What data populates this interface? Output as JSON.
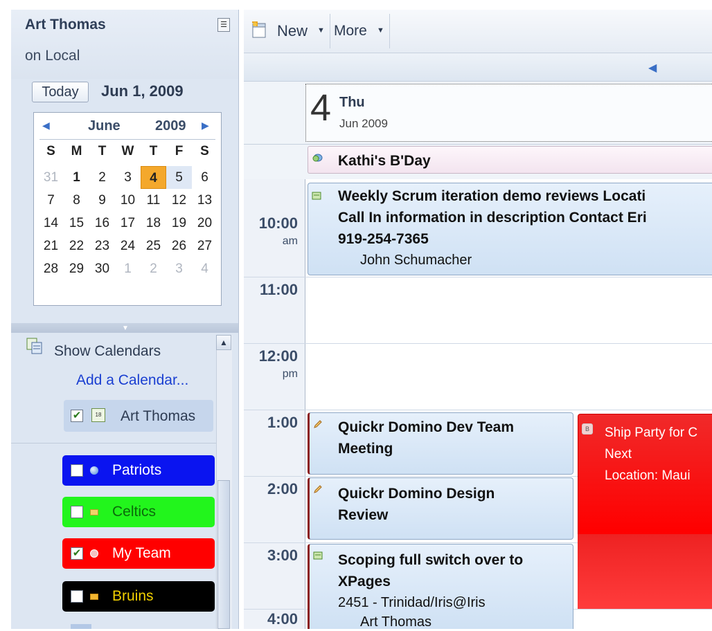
{
  "sidebar": {
    "owner_name": "Art Thomas",
    "owner_location": "on Local",
    "today_button": "Today",
    "current_date": "Jun 1, 2009",
    "mini_calendar": {
      "month": "June",
      "year": "2009",
      "weekdays": [
        "S",
        "M",
        "T",
        "W",
        "T",
        "F",
        "S"
      ],
      "weeks": [
        [
          "31",
          "1",
          "2",
          "3",
          "4",
          "5",
          "6"
        ],
        [
          "7",
          "8",
          "9",
          "10",
          "11",
          "12",
          "13"
        ],
        [
          "14",
          "15",
          "16",
          "17",
          "18",
          "19",
          "20"
        ],
        [
          "21",
          "22",
          "23",
          "24",
          "25",
          "26",
          "27"
        ],
        [
          "28",
          "29",
          "30",
          "1",
          "2",
          "3",
          "4"
        ]
      ]
    },
    "show_calendars": "Show Calendars",
    "add_calendar": "Add a Calendar...",
    "own_calendar": "Art Thomas",
    "calendars": [
      {
        "label": "Patriots",
        "color": "#0a14f0",
        "checked": false
      },
      {
        "label": "Celtics",
        "color": "#22f51c",
        "checked": false
      },
      {
        "label": "My Team",
        "color": "#ff0000",
        "checked": true
      },
      {
        "label": "Bruins",
        "color": "#000000",
        "checked": false
      }
    ]
  },
  "toolbar": {
    "new_label": "New",
    "more_label": "More"
  },
  "day_header": {
    "day_number": "4",
    "day_name": "Thu",
    "month_year": "Jun 2009"
  },
  "all_day_event": "Kathi's B'Day",
  "time_labels": [
    {
      "hour": "10:00",
      "ampm": "am"
    },
    {
      "hour": "11:00",
      "ampm": ""
    },
    {
      "hour": "12:00",
      "ampm": "pm"
    },
    {
      "hour": "1:00",
      "ampm": ""
    },
    {
      "hour": "2:00",
      "ampm": ""
    },
    {
      "hour": "3:00",
      "ampm": ""
    },
    {
      "hour": "4:00",
      "ampm": ""
    }
  ],
  "events": {
    "scrum": {
      "line1": "Weekly Scrum iteration demo reviews Locati",
      "line2": "Call In information in description Contact Eri",
      "line3": "919-254-7365",
      "person": "John Schumacher"
    },
    "dev_meeting": {
      "line1": "Quickr Domino Dev Team",
      "line2": "Meeting"
    },
    "design_review": {
      "line1": "Quickr Domino Design",
      "line2": "Review"
    },
    "scoping": {
      "line1": "Scoping full switch over to",
      "line2": "XPages",
      "location": "2451 - Trinidad/Iris@Iris",
      "person": "Art Thomas"
    },
    "ship_party": {
      "line1": "Ship Party for C",
      "line2": "Next",
      "line3": "Location: Maui"
    }
  },
  "colors": {
    "accent_today": "#f4a82c",
    "event_border": "#8b1b1b",
    "ship_party": "#ff0000"
  }
}
